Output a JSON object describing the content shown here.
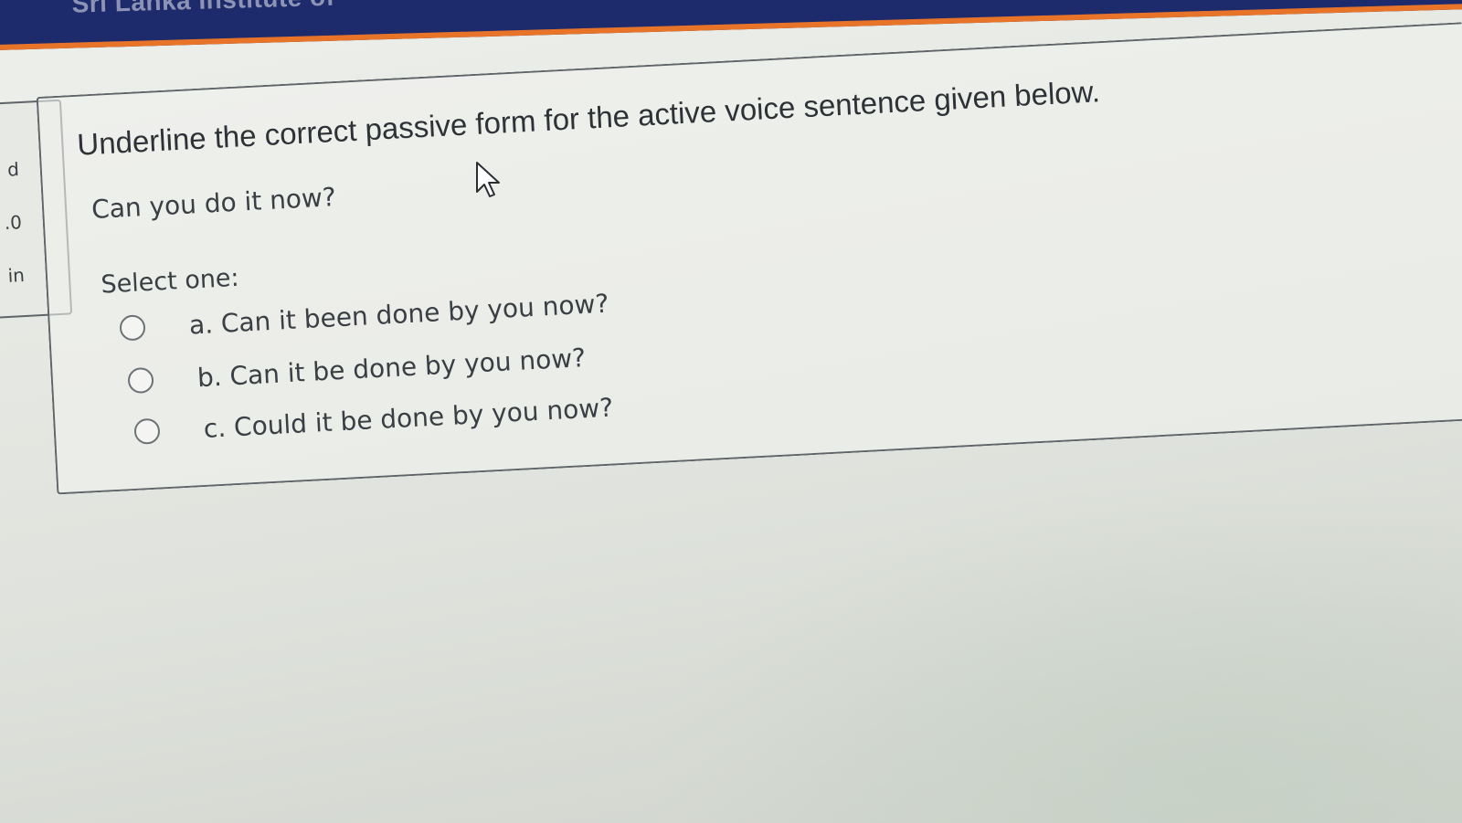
{
  "header": {
    "brand_text": "Sri Lanka Institute of"
  },
  "side_card": {
    "lines": [
      "d",
      ".0",
      "in"
    ]
  },
  "question": {
    "prompt": "Underline the correct passive form for the active voice sentence given below.",
    "sentence": "Can you do it now?",
    "select_label": "Select one:",
    "options": [
      {
        "text": "a. Can it been done by you now?",
        "selected": false
      },
      {
        "text": "b. Can it be done by you now?",
        "selected": false
      },
      {
        "text": "c. Could it be done by you now?",
        "selected": false
      }
    ]
  },
  "colors": {
    "navbar": "#1d2a6b",
    "navbar_accent": "#e8742a",
    "text": "#3a3f44",
    "border": "#5f6468"
  },
  "icons": {
    "cursor": "mouse-pointer-icon",
    "radio": "radio-unchecked-icon"
  }
}
